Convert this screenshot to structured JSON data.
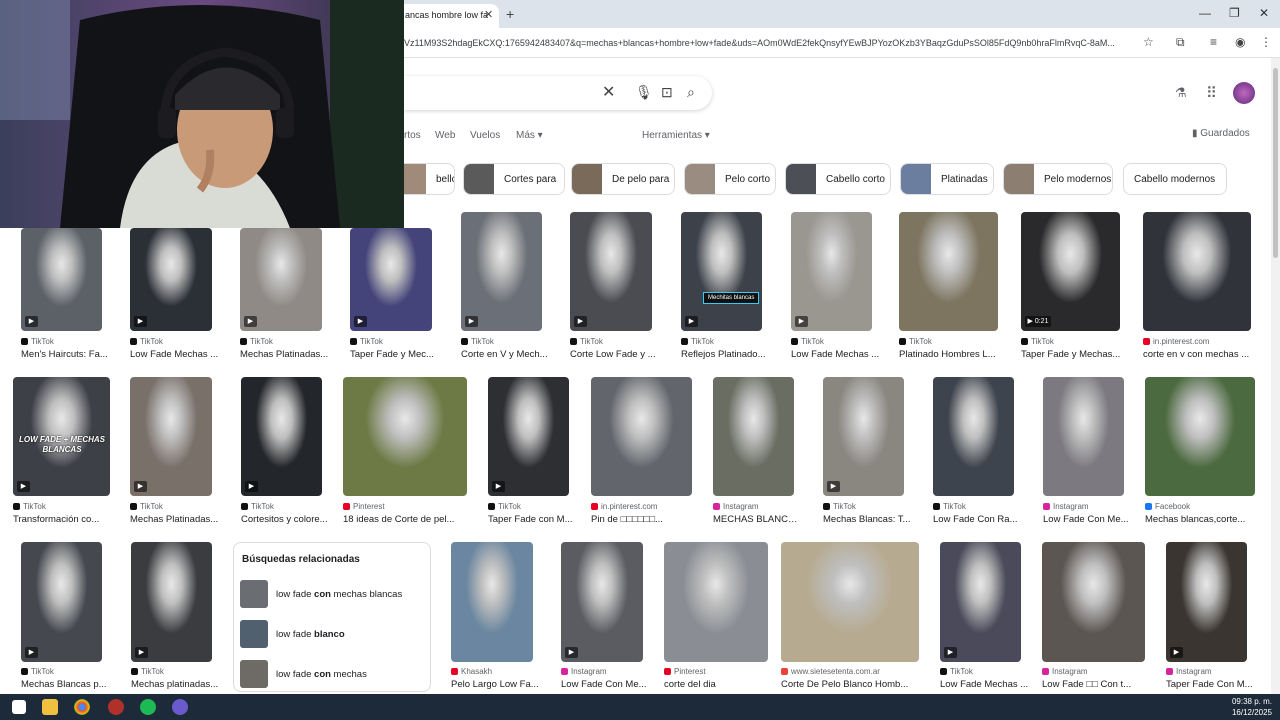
{
  "browser": {
    "tab_title": "ancas hombre low fa",
    "url": "PVz11M93S2hdagEkCXQ:1765942483407&q=mechas+blancas+hombre+low+fade&uds=AOm0WdE2fekQnsyfYEwBJPYozOKzb3YBaqzGduPsSOl85FdQ9nb0hraFlmRvqC-8aM..."
  },
  "header": {
    "nav": [
      "rtos",
      "Web",
      "Vuelos",
      "Más ▾",
      "Herramientas ▾"
    ],
    "saved": "Guardados"
  },
  "chips": [
    {
      "label": "bello para",
      "color": "#a08a7a"
    },
    {
      "label": "Cortes para",
      "color": "#5a5a5a"
    },
    {
      "label": "De pelo para",
      "color": "#7a6a5a"
    },
    {
      "label": "Pelo corto",
      "color": "#9a8c80"
    },
    {
      "label": "Cabello corto",
      "color": "#4c4f55"
    },
    {
      "label": "Platinadas",
      "color": "#6c7ea0"
    },
    {
      "label": "Pelo modernos",
      "color": "#8c7e70"
    },
    {
      "label": "Cabello modernos",
      "color": ""
    }
  ],
  "row1": [
    {
      "source": "TikTok",
      "title": "Men's Haircuts: Fa...",
      "color": "#5c6168",
      "icon": "tiktok",
      "video": "▶"
    },
    {
      "source": "TikTok",
      "title": "Low Fade Mechas ...",
      "color": "#2b2f36",
      "icon": "tiktok",
      "video": "▶"
    },
    {
      "source": "TikTok",
      "title": "Mechas Platinadas...",
      "color": "#8f8a86",
      "icon": "tiktok",
      "video": "▶"
    },
    {
      "source": "TikTok",
      "title": "Taper Fade y Mec...",
      "color": "#44447a",
      "icon": "tiktok",
      "video": "▶"
    },
    {
      "source": "TikTok",
      "title": "Corte en V y Mech...",
      "color": "#6b6f77",
      "icon": "tiktok",
      "video": "▶"
    },
    {
      "source": "TikTok",
      "title": "Corte Low Fade y ...",
      "color": "#4a4c52",
      "icon": "tiktok",
      "video": "▶"
    },
    {
      "source": "TikTok",
      "title": "Reflejos Platinado...",
      "color": "#3c414a",
      "icon": "tiktok",
      "video": "▶",
      "badge": "Mechitas blancas"
    },
    {
      "source": "TikTok",
      "title": "Low Fade Mechas ...",
      "color": "#9a9690",
      "icon": "tiktok",
      "video": "▶"
    },
    {
      "source": "TikTok",
      "title": "Platinado Hombres L...",
      "color": "#7d7560",
      "icon": "tiktok",
      "video": ""
    },
    {
      "source": "TikTok",
      "title": "Taper Fade y Mechas...",
      "color": "#2a2a2c",
      "icon": "tiktok",
      "video": "▶ 0:21"
    },
    {
      "source": "in.pinterest.com",
      "title": "corte en v con mechas ...",
      "color": "#30343a",
      "icon": "pinterest",
      "video": ""
    }
  ],
  "row2": [
    {
      "source": "TikTok",
      "title": "Transformación co...",
      "color": "#3e4048",
      "icon": "tiktok",
      "video": "▶",
      "caption": "LOW FADE + MECHAS BLANCAS"
    },
    {
      "source": "TikTok",
      "title": "Mechas Platinadas...",
      "color": "#7a706a",
      "icon": "tiktok",
      "video": "▶"
    },
    {
      "source": "TikTok",
      "title": "Cortesitos y colore...",
      "color": "#23262a",
      "icon": "tiktok",
      "video": "▶"
    },
    {
      "source": "Pinterest",
      "title": "18 ideas de Corte de pel...",
      "color": "#6d7a45",
      "icon": "pinterest",
      "video": ""
    },
    {
      "source": "TikTok",
      "title": "Taper Fade con M...",
      "color": "#2e2f33",
      "icon": "tiktok",
      "video": "▶"
    },
    {
      "source": "in.pinterest.com",
      "title": "Pin de □□□□□□...",
      "color": "#62666c",
      "icon": "pinterest",
      "video": ""
    },
    {
      "source": "Instagram",
      "title": "MECHAS BLANCA...",
      "color": "#6a6e62",
      "icon": "instagram",
      "video": ""
    },
    {
      "source": "TikTok",
      "title": "Mechas Blancas: T...",
      "color": "#8a8680",
      "icon": "tiktok",
      "video": "▶"
    },
    {
      "source": "TikTok",
      "title": "Low Fade Con Ra...",
      "color": "#3e444d",
      "icon": "tiktok",
      "video": ""
    },
    {
      "source": "Instagram",
      "title": "Low Fade Con Me...",
      "color": "#7c7a80",
      "icon": "instagram",
      "video": ""
    },
    {
      "source": "Facebook",
      "title": "Mechas blancas,corte...",
      "color": "#4c6a40",
      "icon": "facebook",
      "video": ""
    }
  ],
  "row3_left": [
    {
      "source": "TikTok",
      "title": "Mechas Blancas p...",
      "color": "#45494f",
      "icon": "tiktok",
      "video": "▶"
    },
    {
      "source": "TikTok",
      "title": "Mechas platinadas...",
      "color": "#3a3c40",
      "icon": "tiktok",
      "video": "▶"
    }
  ],
  "related": {
    "heading": "Búsquedas relacionadas",
    "items": [
      {
        "pre": "low fade ",
        "bold": "con",
        "post": " mechas blancas",
        "color": "#6a6e72"
      },
      {
        "pre": "low fade ",
        "bold": "blanco",
        "post": "",
        "color": "#50606e"
      },
      {
        "pre": "low fade ",
        "bold": "con",
        "post": " mechas",
        "color": "#6e6a66"
      }
    ]
  },
  "row3_right": [
    {
      "source": "Khasakh",
      "title": "Pelo Largo Low Fa...",
      "color": "#6a86a0",
      "icon": "pinterest",
      "video": ""
    },
    {
      "source": "Instagram",
      "title": "Low Fade Con Me...",
      "color": "#5a5c62",
      "icon": "instagram",
      "video": "▶"
    },
    {
      "source": "Pinterest",
      "title": "corte del dia",
      "color": "#8a8e94",
      "icon": "pinterest",
      "video": ""
    },
    {
      "source": "www.sietesetenta.com.ar",
      "title": "Corte De Pelo Blanco Homb...",
      "color": "#b6aa90",
      "icon": "web",
      "video": ""
    },
    {
      "source": "TikTok",
      "title": "Low Fade Mechas ...",
      "color": "#4a4a5a",
      "icon": "tiktok",
      "video": "▶"
    },
    {
      "source": "Instagram",
      "title": "Low Fade □□ Con t...",
      "color": "#5c5652",
      "icon": "instagram",
      "video": ""
    },
    {
      "source": "Instagram",
      "title": "Taper Fade Con M...",
      "color": "#3a3530",
      "icon": "instagram",
      "video": "▶"
    }
  ],
  "taskbar": {
    "time": "09:38 p. m.",
    "date": "16/12/2025"
  }
}
